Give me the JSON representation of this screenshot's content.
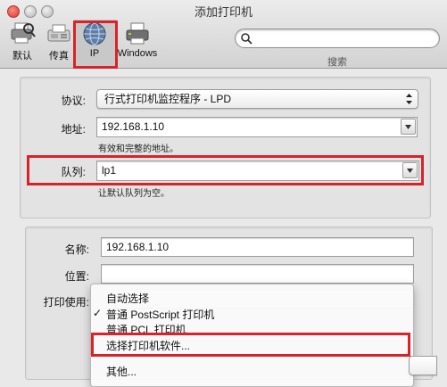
{
  "window": {
    "title": "添加打印机"
  },
  "toolbar": {
    "items": [
      {
        "label": "默认",
        "icon": "default-printer-icon"
      },
      {
        "label": "传真",
        "icon": "fax-icon"
      },
      {
        "label": "IP",
        "icon": "ip-globe-icon"
      },
      {
        "label": "Windows",
        "icon": "windows-printer-icon"
      }
    ],
    "selected": "IP",
    "search_label": "搜索"
  },
  "connection": {
    "protocol_label": "协议:",
    "protocol_value": "行式打印机监控程序 - LPD",
    "address_label": "地址:",
    "address_value": "192.168.1.10",
    "address_hint": "有效和完整的地址。",
    "queue_label": "队列:",
    "queue_value": "lp1",
    "queue_hint": "让默认队列为空。"
  },
  "details": {
    "name_label": "名称:",
    "name_value": "192.168.1.10",
    "location_label": "位置:",
    "location_value": "",
    "use_label": "打印使用:"
  },
  "menu": {
    "items": [
      {
        "label": "自动选择",
        "checked": false
      },
      {
        "label": "普通 PostScript 打印机",
        "checked": true
      },
      {
        "label": "普通 PCL 打印机",
        "checked": false
      },
      {
        "label": "选择打印机软件...",
        "checked": false
      },
      {
        "label": "其他...",
        "checked": false
      }
    ],
    "check_mark": "✓"
  },
  "colors": {
    "highlight_border": "#d8232a",
    "window_bg": "#e9e9e9"
  }
}
